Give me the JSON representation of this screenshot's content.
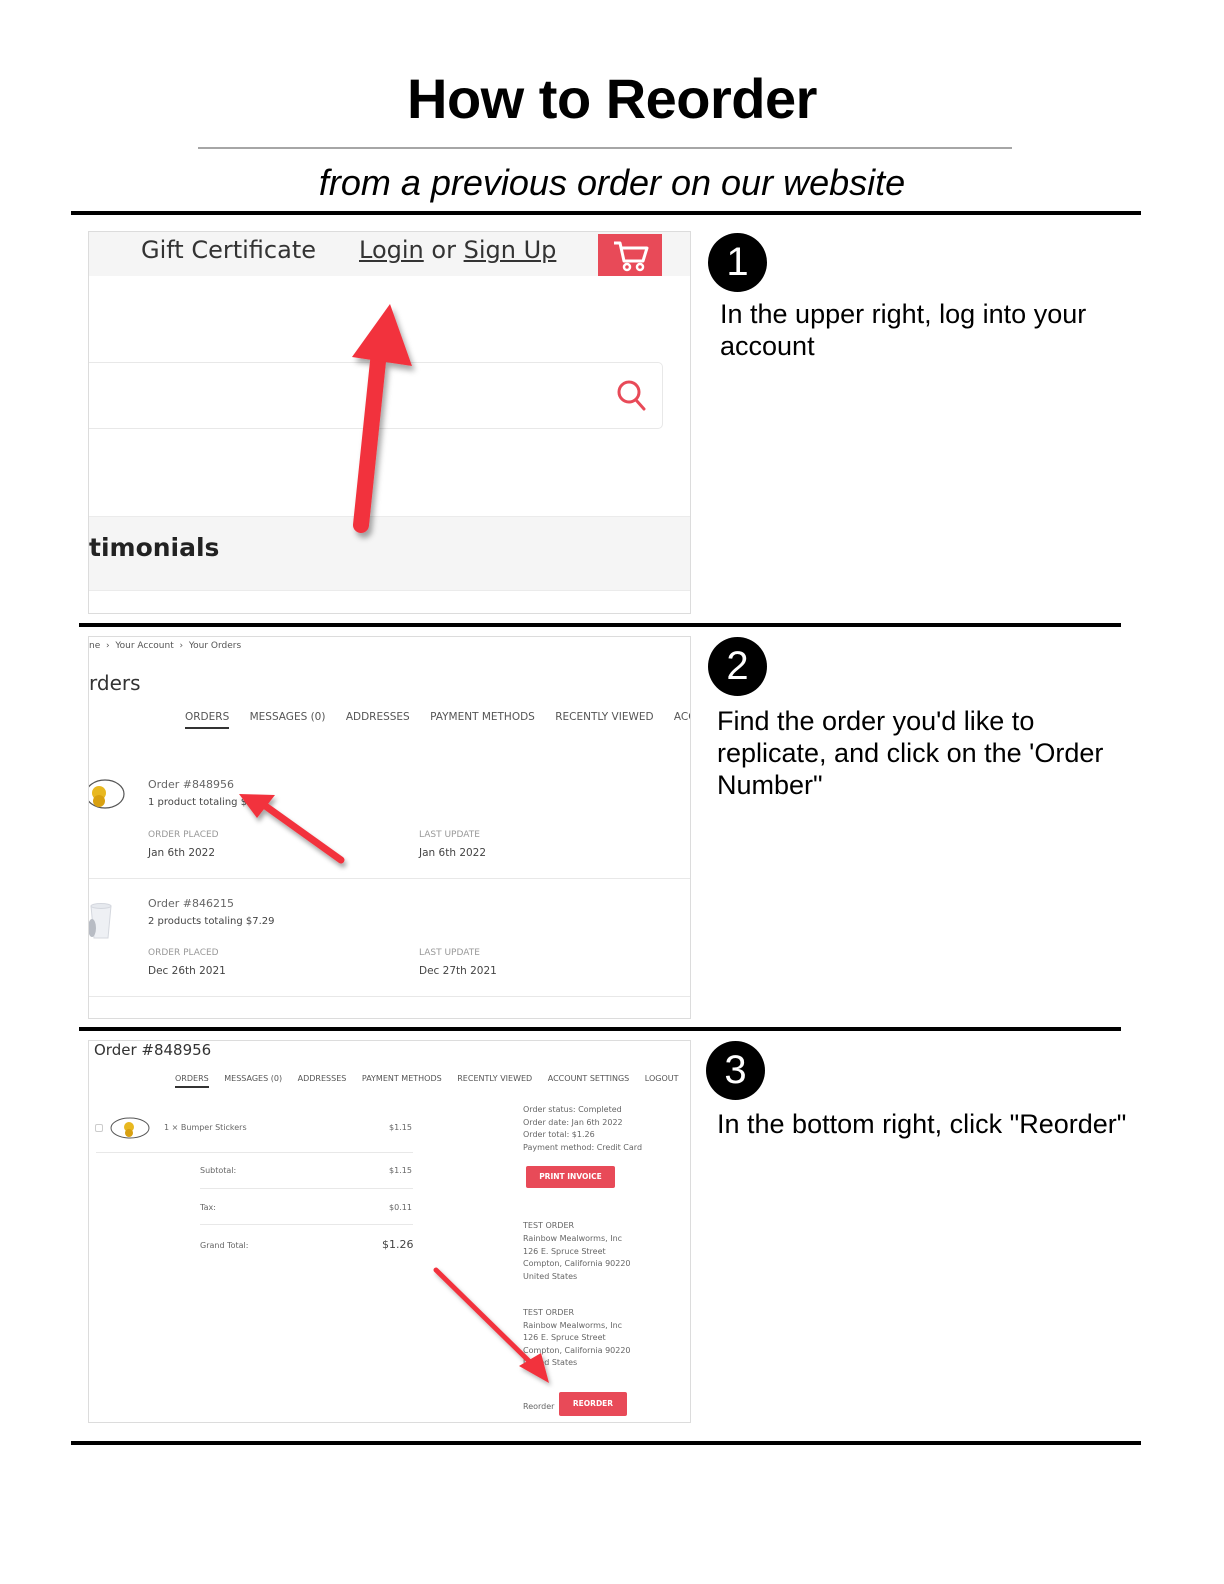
{
  "header": {
    "title": "How to Reorder",
    "subtitle": "from a previous order on our website"
  },
  "steps": [
    {
      "number": "1",
      "text": "In the upper right, log into your account",
      "screenshot": {
        "gift_certificate": "Gift Certificate",
        "login": "Login",
        "or": "or",
        "sign_up": "Sign Up",
        "cart_icon": "shopping-cart-icon",
        "search_icon": "search-icon",
        "search_placeholder": "",
        "section_label": "timonials"
      }
    },
    {
      "number": "2",
      "text": "Find the order you'd like to replicate, and click on the 'Order Number\"",
      "screenshot": {
        "breadcrumb": [
          "ne",
          "Your Account",
          "Your Orders"
        ],
        "breadcrumb_sep": "›",
        "heading": "rders",
        "tabs": [
          "ORDERS",
          "MESSAGES (0)",
          "ADDRESSES",
          "PAYMENT METHODS",
          "RECENTLY VIEWED",
          "ACC"
        ],
        "orders": [
          {
            "number": "Order #848956",
            "summary": "1 product totaling $",
            "placed_label": "ORDER PLACED",
            "placed": "Jan 6th 2022",
            "update_label": "LAST UPDATE",
            "updated": "Jan 6th 2022"
          },
          {
            "number": "Order #846215",
            "summary": "2 products totaling $7.29",
            "placed_label": "ORDER PLACED",
            "placed": "Dec 26th 2021",
            "update_label": "LAST UPDATE",
            "updated": "Dec 27th 2021"
          }
        ]
      }
    },
    {
      "number": "3",
      "text": "In the bottom right, click \"Reorder\"",
      "screenshot": {
        "heading": "Order #848956",
        "tabs": [
          "ORDERS",
          "MESSAGES (0)",
          "ADDRESSES",
          "PAYMENT METHODS",
          "RECENTLY VIEWED",
          "ACCOUNT SETTINGS",
          "LOGOUT"
        ],
        "item": {
          "description": "1 × Bumper Stickers",
          "price": "$1.15"
        },
        "totals": [
          {
            "label": "Subtotal:",
            "value": "$1.15"
          },
          {
            "label": "Tax:",
            "value": "$0.11"
          },
          {
            "label": "Grand Total:",
            "value": "$1.26"
          }
        ],
        "status": [
          "Order status: Completed",
          "Order date: Jan 6th 2022",
          "Order total: $1.26",
          "Payment method: Credit Card"
        ],
        "print_invoice": "PRINT INVOICE",
        "addresses": [
          [
            "TEST ORDER",
            "Rainbow Mealworms, Inc",
            "126 E. Spruce Street",
            "Compton, California 90220",
            "United States"
          ],
          [
            "TEST ORDER",
            "Rainbow Mealworms, Inc",
            "126 E. Spruce Street",
            "Compton, California 90220",
            "United States"
          ]
        ],
        "reorder_label": "Reorder",
        "reorder_button": "REORDER"
      }
    }
  ],
  "colors": {
    "accent_red": "#e84a58",
    "arrow_red": "#f2323c"
  }
}
